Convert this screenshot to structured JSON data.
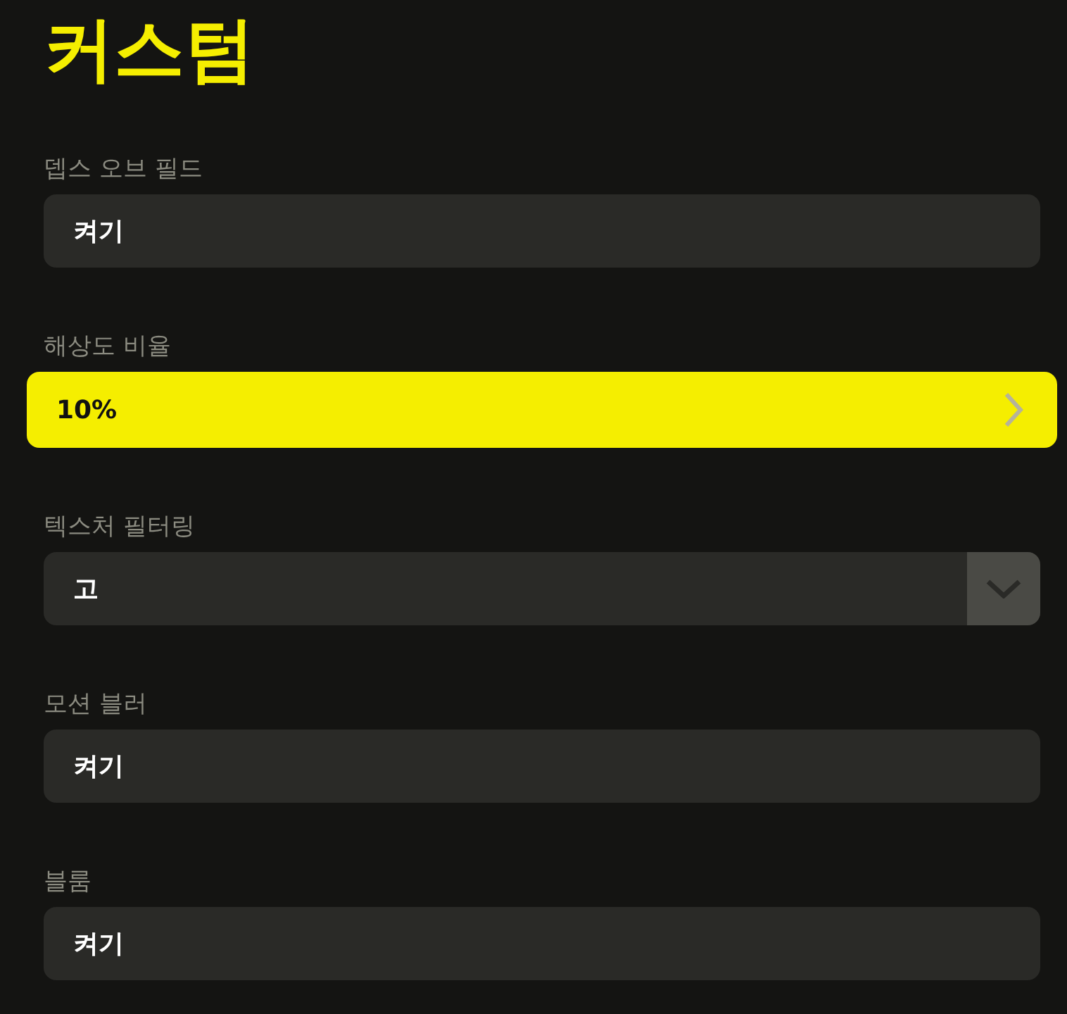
{
  "title": "커스텀",
  "settings": [
    {
      "label": "뎁스 오브 필드",
      "value": "켜기",
      "kind": "value",
      "selected": false
    },
    {
      "label": "해상도 비율",
      "value": "10%",
      "kind": "value",
      "selected": true
    },
    {
      "label": "텍스처 필터링",
      "value": "고",
      "kind": "dropdown",
      "selected": false
    },
    {
      "label": "모션 블러",
      "value": "켜기",
      "kind": "value",
      "selected": false
    },
    {
      "label": "블룸",
      "value": "켜기",
      "kind": "value",
      "selected": false
    }
  ]
}
